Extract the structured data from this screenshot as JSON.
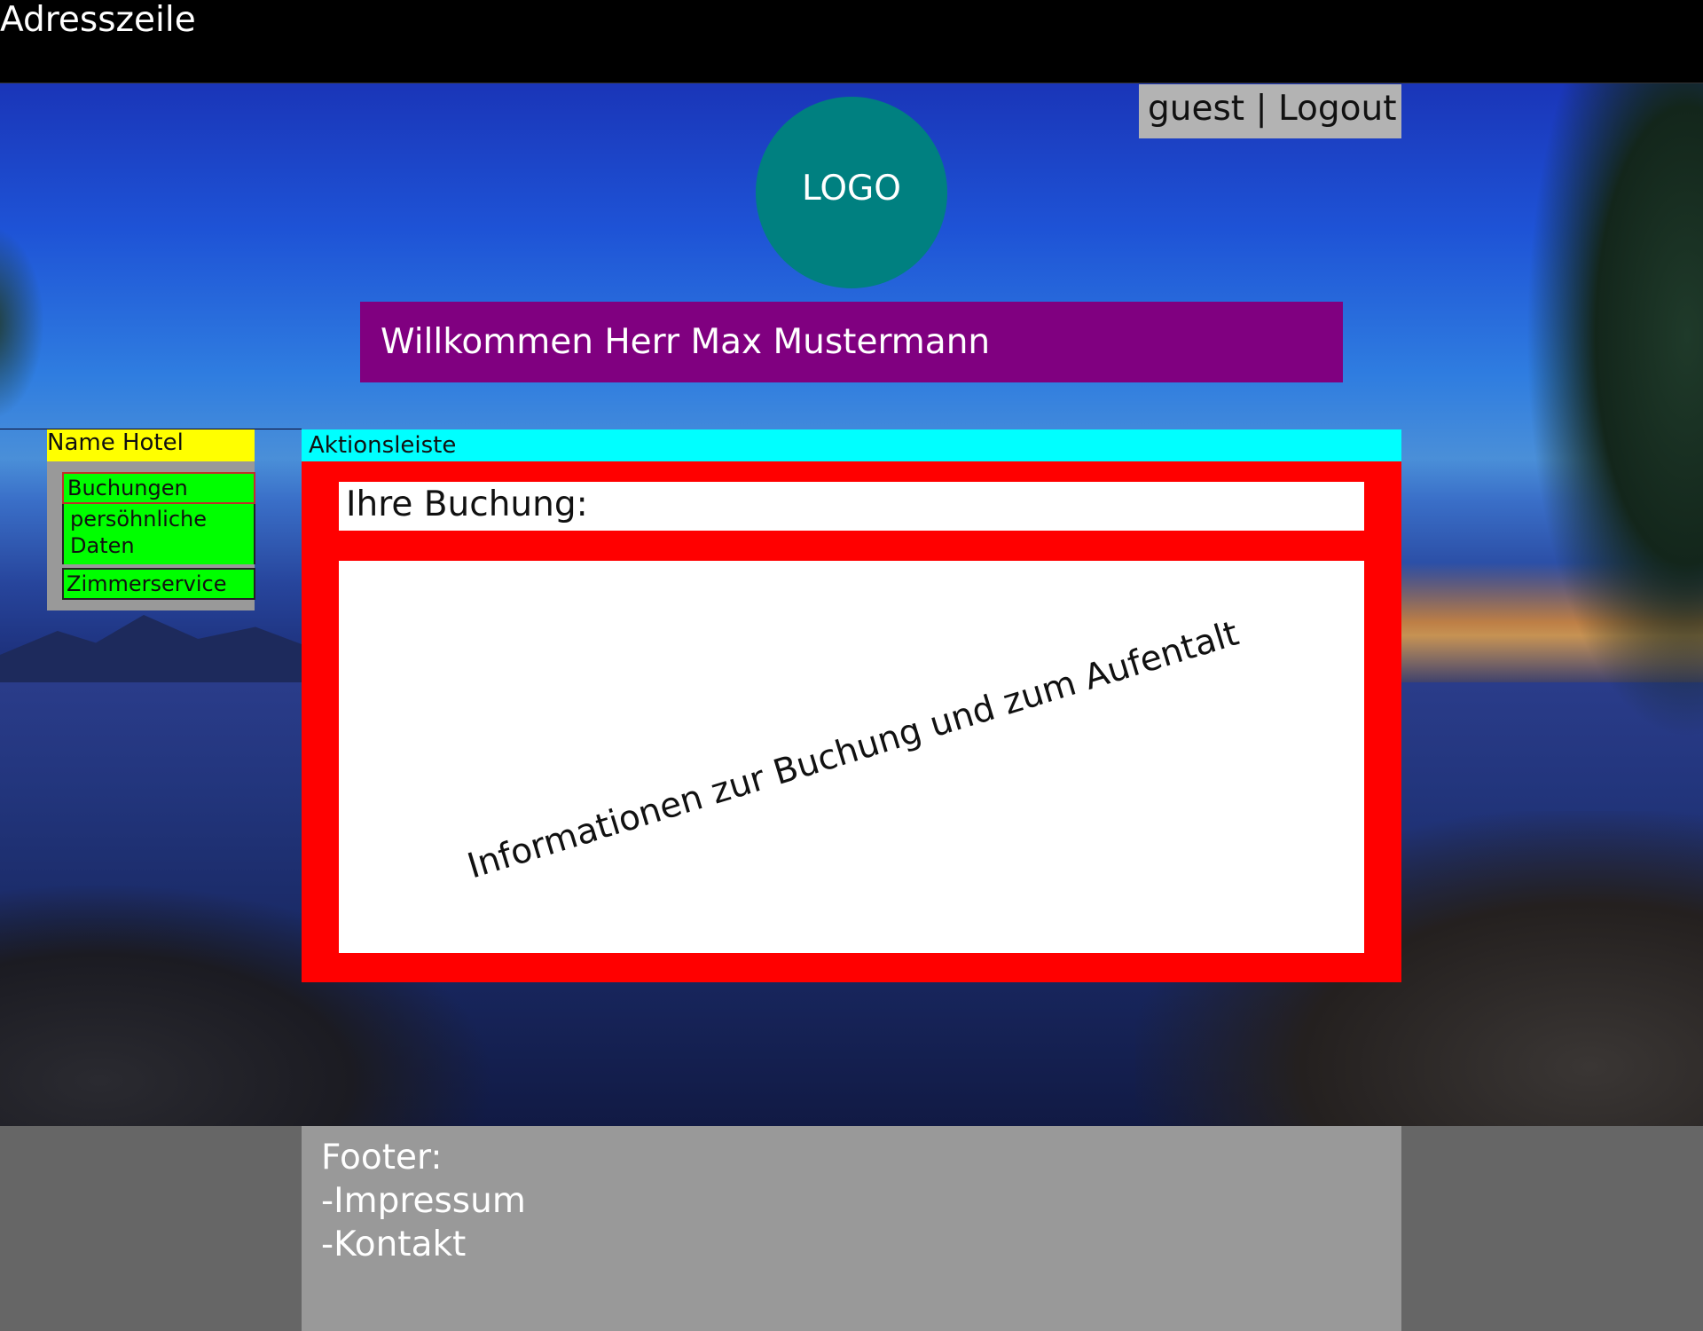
{
  "address_bar": {
    "label": "Adresszeile"
  },
  "header": {
    "login_status": "guest | Logout",
    "logo_text": "LOGO",
    "welcome_text": "Willkommen Herr Max Mustermann"
  },
  "sidebar": {
    "hotel_name": "Name Hotel",
    "items": [
      {
        "label": "Buchungen"
      },
      {
        "label": "persöhnliche Daten"
      },
      {
        "label": "Zimmerservice"
      }
    ]
  },
  "action_bar": {
    "label": "Aktionsleiste"
  },
  "main": {
    "heading": "Ihre Buchung:",
    "info_text": "Informationen zur Buchung und zum Aufentalt"
  },
  "footer": {
    "title": "Footer:",
    "links": [
      "-Impressum",
      "-Kontakt"
    ]
  },
  "colors": {
    "address_bar": "#000000",
    "login_box": "#b3b3b3",
    "logo": "#008080",
    "welcome_banner": "#800080",
    "hotel_name": "#ffff00",
    "nav_item": "#00ff00",
    "action_bar": "#00ffff",
    "main_frame": "#ff0000",
    "footer": "#999999",
    "page_bottom": "#666666"
  }
}
